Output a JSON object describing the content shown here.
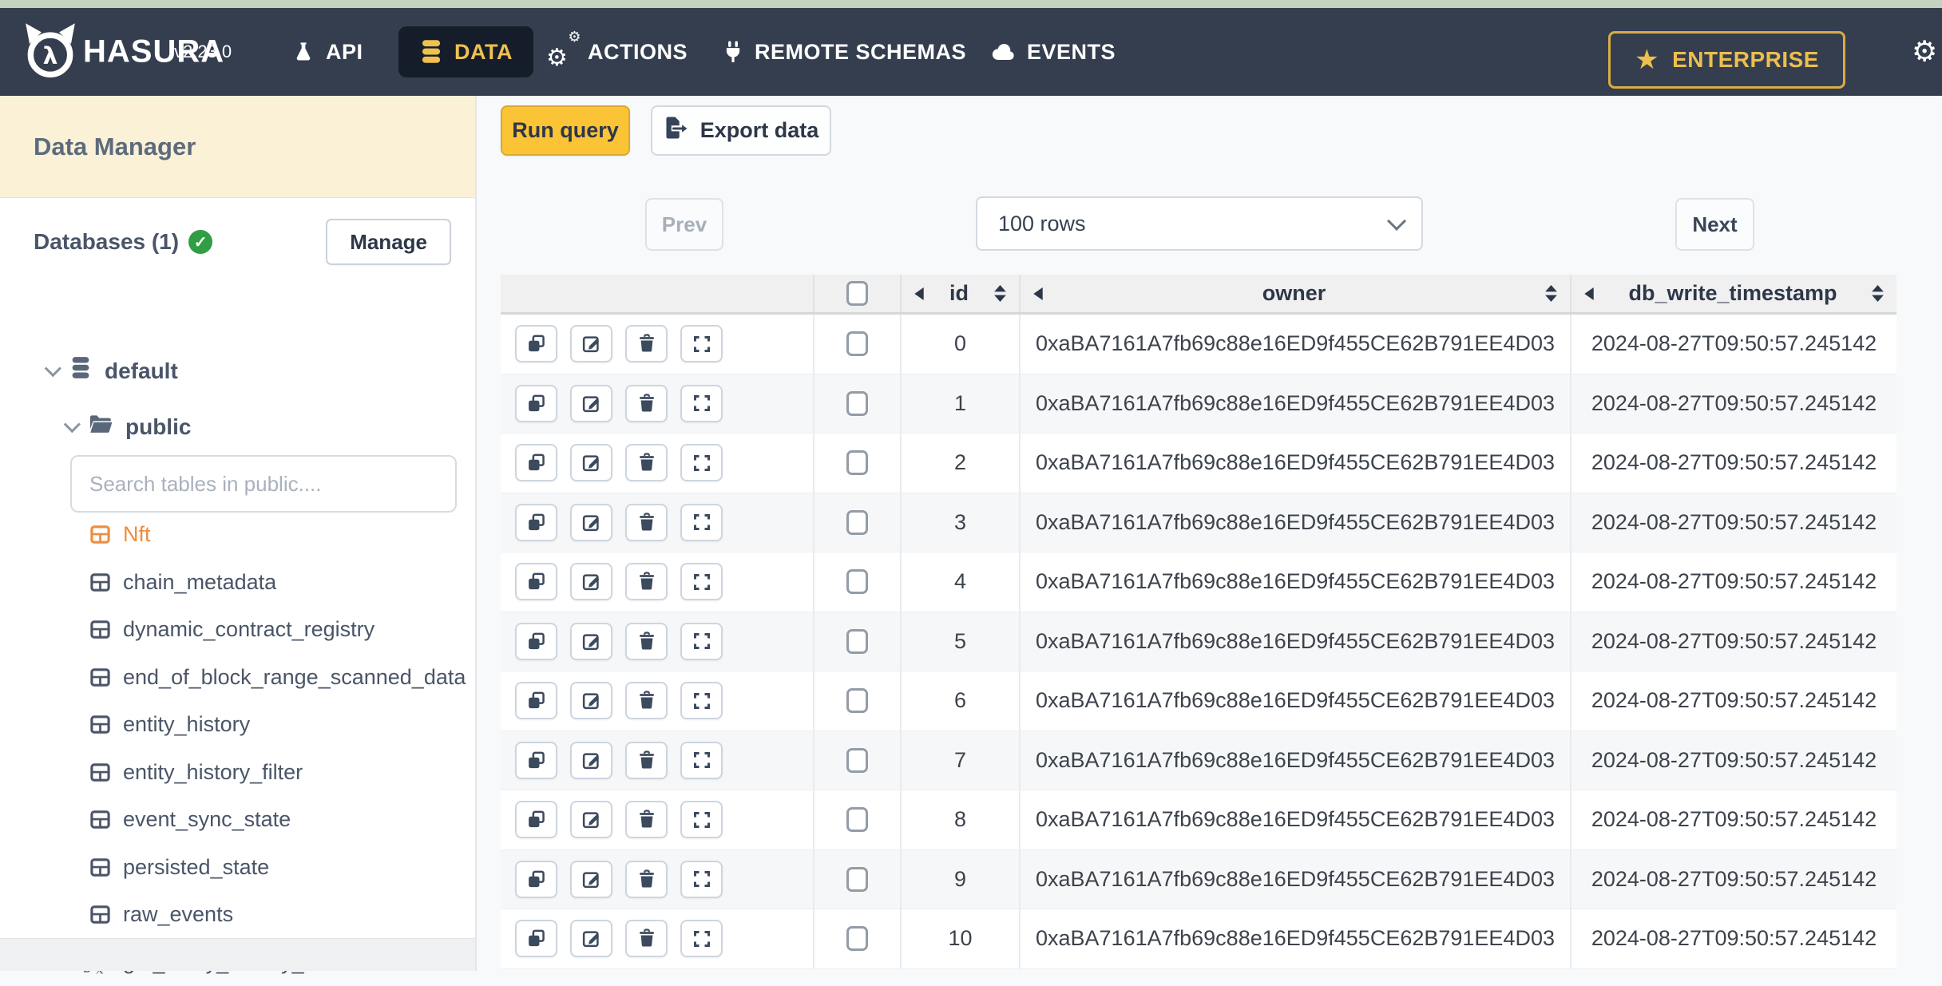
{
  "colors": {
    "nav_bg": "#353E4F",
    "nav_active_bg": "#161D2A",
    "accent_yellow": "#EFC14F",
    "run_query_bg": "#FBC437",
    "sidebar_band": "#FBF1D7",
    "active_table": "#F08C3B",
    "header_bg": "#F0F0F1",
    "stripe_bg": "#F6F7F8",
    "success_green": "#2F9E44"
  },
  "topbar": {
    "brand": "HASURA",
    "version": "v2.23.0",
    "nav": [
      {
        "label": "API",
        "icon": "flask-icon",
        "active": false
      },
      {
        "label": "DATA",
        "icon": "database-icon",
        "active": true
      },
      {
        "label": "ACTIONS",
        "icon": "gears-icon",
        "active": false
      },
      {
        "label": "REMOTE SCHEMAS",
        "icon": "plug-icon",
        "active": false
      },
      {
        "label": "EVENTS",
        "icon": "cloud-icon",
        "active": false
      }
    ],
    "enterprise": "ENTERPRISE"
  },
  "sidebar": {
    "title": "Data Manager",
    "databases_label": "Databases (1)",
    "manage": "Manage",
    "database_name": "default",
    "schema_name": "public",
    "search_placeholder": "Search tables in public....",
    "items": [
      {
        "label": "Nft",
        "kind": "table",
        "active": true
      },
      {
        "label": "chain_metadata",
        "kind": "table",
        "active": false
      },
      {
        "label": "dynamic_contract_registry",
        "kind": "table",
        "active": false
      },
      {
        "label": "end_of_block_range_scanned_data",
        "kind": "table",
        "active": false
      },
      {
        "label": "entity_history",
        "kind": "table",
        "active": false
      },
      {
        "label": "entity_history_filter",
        "kind": "table",
        "active": false
      },
      {
        "label": "event_sync_state",
        "kind": "table",
        "active": false
      },
      {
        "label": "persisted_state",
        "kind": "table",
        "active": false
      },
      {
        "label": "raw_events",
        "kind": "table",
        "active": false
      },
      {
        "label": "get_entity_history_filter",
        "kind": "function",
        "active": false
      }
    ]
  },
  "toolbar": {
    "run_query": "Run query",
    "export_data": "Export data"
  },
  "pagination": {
    "prev": "Prev",
    "page_size": "100 rows",
    "next": "Next"
  },
  "grid": {
    "headers": {
      "id": "id",
      "owner": "owner",
      "timestamp": "db_write_timestamp"
    },
    "rows": [
      {
        "id": "0",
        "owner": "0xaBA7161A7fb69c88e16ED9f455CE62B791EE4D03",
        "db_write_timestamp": "2024-08-27T09:50:57.245142"
      },
      {
        "id": "1",
        "owner": "0xaBA7161A7fb69c88e16ED9f455CE62B791EE4D03",
        "db_write_timestamp": "2024-08-27T09:50:57.245142"
      },
      {
        "id": "2",
        "owner": "0xaBA7161A7fb69c88e16ED9f455CE62B791EE4D03",
        "db_write_timestamp": "2024-08-27T09:50:57.245142"
      },
      {
        "id": "3",
        "owner": "0xaBA7161A7fb69c88e16ED9f455CE62B791EE4D03",
        "db_write_timestamp": "2024-08-27T09:50:57.245142"
      },
      {
        "id": "4",
        "owner": "0xaBA7161A7fb69c88e16ED9f455CE62B791EE4D03",
        "db_write_timestamp": "2024-08-27T09:50:57.245142"
      },
      {
        "id": "5",
        "owner": "0xaBA7161A7fb69c88e16ED9f455CE62B791EE4D03",
        "db_write_timestamp": "2024-08-27T09:50:57.245142"
      },
      {
        "id": "6",
        "owner": "0xaBA7161A7fb69c88e16ED9f455CE62B791EE4D03",
        "db_write_timestamp": "2024-08-27T09:50:57.245142"
      },
      {
        "id": "7",
        "owner": "0xaBA7161A7fb69c88e16ED9f455CE62B791EE4D03",
        "db_write_timestamp": "2024-08-27T09:50:57.245142"
      },
      {
        "id": "8",
        "owner": "0xaBA7161A7fb69c88e16ED9f455CE62B791EE4D03",
        "db_write_timestamp": "2024-08-27T09:50:57.245142"
      },
      {
        "id": "9",
        "owner": "0xaBA7161A7fb69c88e16ED9f455CE62B791EE4D03",
        "db_write_timestamp": "2024-08-27T09:50:57.245142"
      },
      {
        "id": "10",
        "owner": "0xaBA7161A7fb69c88e16ED9f455CE62B791EE4D03",
        "db_write_timestamp": "2024-08-27T09:50:57.245142"
      }
    ]
  }
}
